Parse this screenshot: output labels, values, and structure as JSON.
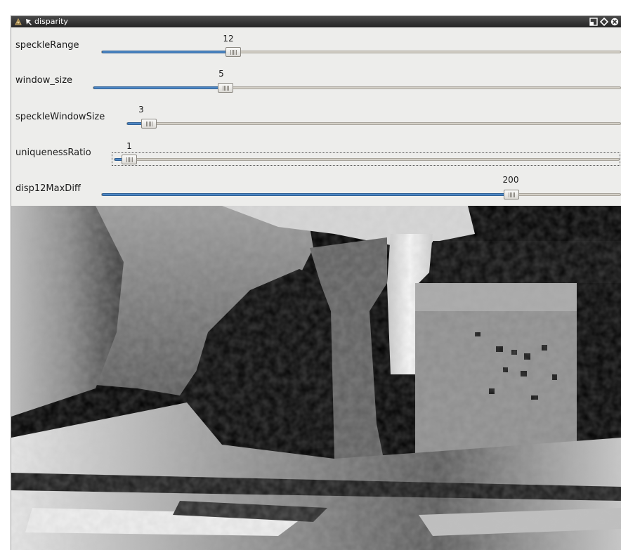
{
  "window": {
    "title": "disparity"
  },
  "trackbars": [
    {
      "label": "speckleRange",
      "value": "12",
      "fraction": 0.246
    },
    {
      "label": "window_size",
      "value": "5",
      "fraction": 0.243
    },
    {
      "label": "speckleWindowSize",
      "value": "3",
      "fraction": 0.03
    },
    {
      "label": "uniquenessRatio",
      "value": "1",
      "fraction": 0.015
    },
    {
      "label": "disp12MaxDiff",
      "value": "200",
      "fraction": 0.799
    }
  ],
  "image": {
    "content": "disparity-map"
  },
  "colors": {
    "titlebar": "#333333",
    "panel": "#ededeb",
    "fill": "#4d87c4",
    "track": "#d4d0c7"
  }
}
